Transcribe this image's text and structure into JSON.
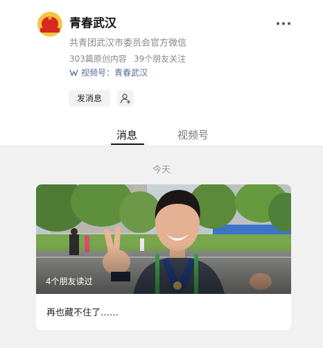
{
  "account": {
    "name": "青春武汉",
    "description": "共青团武汉市委员会官方微信",
    "original_count": "303篇原创内容",
    "followers": "39个朋友关注",
    "channel_prefix": "视频号：",
    "channel_name": "青春武汉"
  },
  "actions": {
    "send_message": "发消息"
  },
  "tabs": [
    {
      "label": "消息",
      "active": true
    },
    {
      "label": "视频号",
      "active": false
    }
  ],
  "feed": {
    "date_label": "今天",
    "articles": [
      {
        "title": "再也藏不住了……",
        "read_by": "4个朋友读过",
        "image_icon": "photo-icon"
      }
    ]
  },
  "colors": {
    "link": "#576b95",
    "feed_background": "#f1f1f1",
    "logo_red": "#d62a1e",
    "logo_yellow": "#f6c543"
  }
}
